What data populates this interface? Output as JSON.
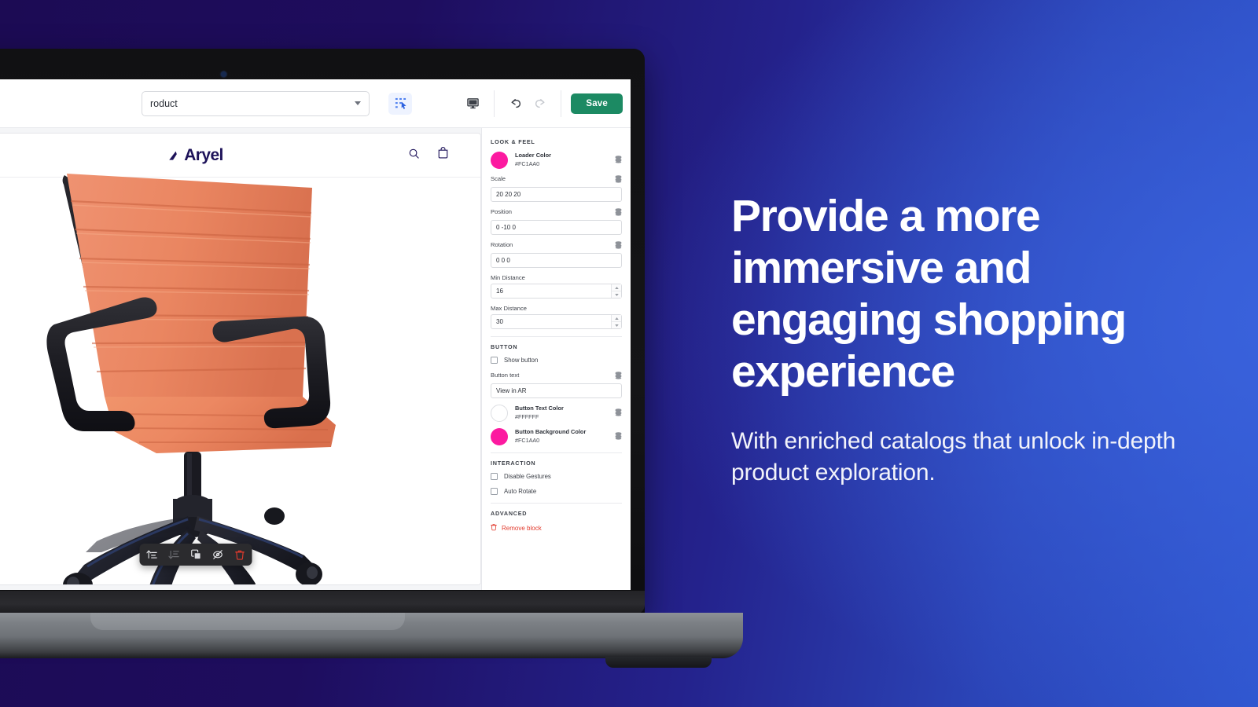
{
  "background": {
    "from_color": "#1C0B54",
    "to_color": "#2F56CF"
  },
  "device": {
    "name": "laptop-mockup"
  },
  "editor": {
    "toolbar": {
      "project_select_value": "roduct",
      "select_tool_icon": "marquee-select-icon",
      "preview_device_icon": "desktop-monitor-icon",
      "undo_icon": "undo-arrow-icon",
      "redo_icon": "redo-arrow-icon",
      "save_label": "Save",
      "save_color": "#1C8A63"
    },
    "storefront": {
      "logo_text": "Aryel",
      "logo_color": "#1D1259",
      "search_icon": "search-icon",
      "cart_icon": "shopping-bag-icon"
    },
    "block_toolbar": {
      "items": [
        {
          "name": "move-forward-icon",
          "enabled": true
        },
        {
          "name": "move-backward-icon",
          "enabled": false
        },
        {
          "name": "duplicate-icon",
          "enabled": true
        },
        {
          "name": "hide-icon",
          "enabled": true
        },
        {
          "name": "delete-icon",
          "enabled": true
        }
      ]
    },
    "panel": {
      "sections": {
        "look_and_feel": "LOOK & FEEL",
        "button": "BUTTON",
        "interaction": "INTERACTION",
        "advanced": "ADVANCED"
      },
      "loader_color": {
        "label": "Loader Color",
        "hex": "#FC1AA0"
      },
      "scale": {
        "label": "Scale",
        "value": "20 20 20"
      },
      "position": {
        "label": "Position",
        "value": "0 -10 0"
      },
      "rotation": {
        "label": "Rotation",
        "value": "0 0 0"
      },
      "min_distance": {
        "label": "Min Distance",
        "value": "16"
      },
      "max_distance": {
        "label": "Max Distance",
        "value": "30"
      },
      "show_button": {
        "label": "Show button",
        "checked": false
      },
      "button_text": {
        "label": "Button text",
        "value": "View in AR"
      },
      "button_text_color": {
        "label": "Button Text Color",
        "hex": "#FFFFFF"
      },
      "button_background_color": {
        "label": "Button Background Color",
        "hex": "#FC1AA0"
      },
      "disable_gestures": {
        "label": "Disable Gestures",
        "checked": false
      },
      "auto_rotate": {
        "label": "Auto Rotate",
        "checked": false
      },
      "remove_block": {
        "label": "Remove block",
        "icon": "trash-icon",
        "color": "#E23B2E"
      },
      "data_source_icon": "database-stack-icon"
    },
    "model": {
      "name": "orange-office-chair",
      "body_color": "#E8865E",
      "frame_color": "#1D1D22"
    }
  },
  "marketing": {
    "headline": "Provide a more immersive and engaging shopping experience",
    "subcopy": "With enriched catalogs that unlock in-depth product exploration."
  }
}
